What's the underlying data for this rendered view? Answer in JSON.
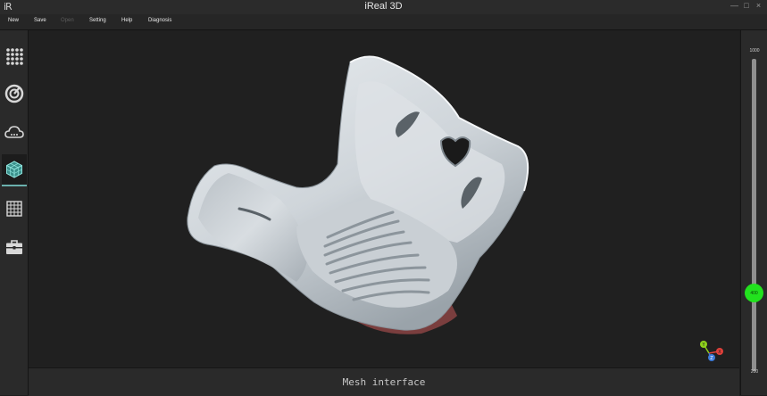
{
  "app": {
    "logo": "iR",
    "title": "iReal 3D"
  },
  "window_controls": {
    "minimize": "—",
    "maximize": "□",
    "close": "×"
  },
  "menu": [
    {
      "label": "New",
      "enabled": true
    },
    {
      "label": "Save",
      "enabled": true
    },
    {
      "label": "Open",
      "enabled": false
    },
    {
      "label": "Setting",
      "enabled": true
    },
    {
      "label": "Help",
      "enabled": true
    },
    {
      "label": "Diagnosis",
      "enabled": true
    }
  ],
  "toolbar": [
    {
      "icon": "grid-dots-icon",
      "active": false
    },
    {
      "icon": "scan-target-icon",
      "active": false
    },
    {
      "icon": "cloud-icon",
      "active": false
    },
    {
      "icon": "mesh-cube-icon",
      "active": true
    },
    {
      "icon": "grid-table-icon",
      "active": false
    },
    {
      "icon": "toolbox-icon",
      "active": false
    }
  ],
  "status": {
    "text": "Mesh interface"
  },
  "slider": {
    "max": "1000",
    "min": "200",
    "value": "400"
  },
  "axes": {
    "x": "X",
    "y": "Y",
    "z": "Z"
  },
  "colors": {
    "accent": "#6ab0ad",
    "slider_thumb": "#22e21e",
    "axis_x": "#e0403a",
    "axis_y": "#8fd21c",
    "axis_z": "#3c7ad8"
  }
}
